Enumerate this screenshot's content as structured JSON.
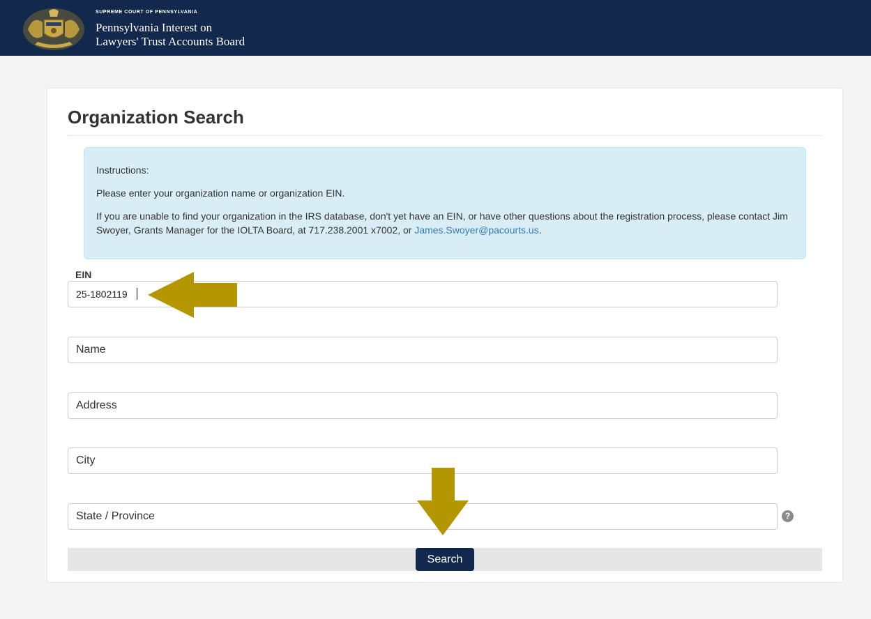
{
  "header": {
    "subtitle": "SUPREME COURT OF PENNSYLVANIA",
    "title_line1": "Pennsylvania Interest on",
    "title_line2": "Lawyers' Trust Accounts Board",
    "seal_icon": "pennsylvania-coat-of-arms-seal",
    "background_color": "#12284c"
  },
  "page": {
    "title": "Organization Search"
  },
  "instructions": {
    "heading": "Instructions:",
    "line1": "Please enter your organization name or organization EIN.",
    "line2": "If you are unable to find your organization in the IRS database, don't yet have an EIN, or have other questions about the registration process, please contact Jim Swoyer, Grants Manager for the IOLTA Board, at 717.238.2001 x7002, or",
    "email_link": "James.Swoyer@pacourts.us",
    "trailing": "."
  },
  "form": {
    "ein_label": "EIN",
    "ein_value": "25-1802119",
    "name_placeholder": "Name",
    "address_placeholder": "Address",
    "city_placeholder": "City",
    "state_placeholder": "State / Province",
    "help_icon": "question-circle-icon",
    "search_label": "Search"
  },
  "annotations": {
    "arrow_color": "#b39600",
    "arrow_to_ein": "left-arrow",
    "arrow_to_search": "down-arrow"
  }
}
